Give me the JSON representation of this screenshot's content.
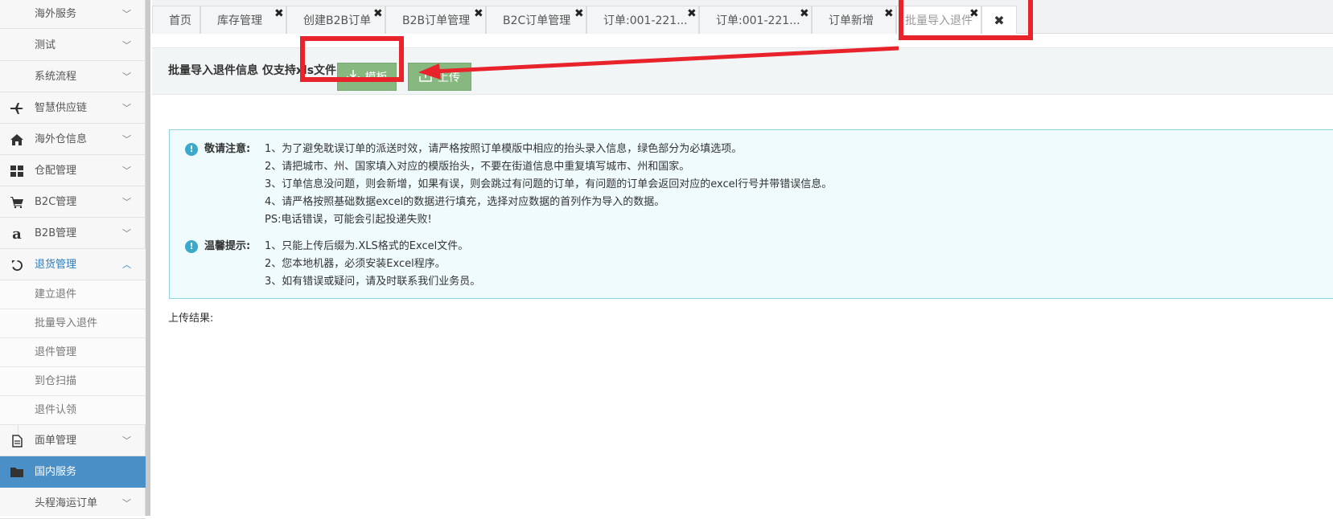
{
  "sidebar": {
    "items": [
      {
        "label": "海外服务",
        "icon": "none"
      },
      {
        "label": "测试",
        "icon": "none"
      },
      {
        "label": "系统流程",
        "icon": "none"
      },
      {
        "label": "智慧供应链",
        "icon": "plane-icon"
      },
      {
        "label": "海外仓信息",
        "icon": "home-icon"
      },
      {
        "label": "仓配管理",
        "icon": "grid-icon"
      },
      {
        "label": "B2C管理",
        "icon": "cart-icon"
      },
      {
        "label": "B2B管理",
        "icon": "amazon-icon"
      },
      {
        "label": "退货管理",
        "icon": "undo-icon"
      }
    ],
    "sub_items": [
      "建立退件",
      "批量导入退件",
      "退件管理",
      "到仓扫描",
      "退件认领"
    ],
    "after_items": [
      {
        "label": "面单管理",
        "icon": "file-icon"
      },
      {
        "label": "国内服务",
        "icon": "folder-icon"
      },
      {
        "label": "头程海运订单",
        "icon": "none"
      }
    ],
    "chevron_down": "﹀",
    "chevron_up": "︿"
  },
  "tabs": [
    {
      "label": "首页",
      "closable": false
    },
    {
      "label": "库存管理",
      "closable": true
    },
    {
      "label": "创建B2B订单",
      "closable": true
    },
    {
      "label": "B2B订单管理",
      "closable": true
    },
    {
      "label": "B2C订单管理",
      "closable": true
    },
    {
      "label": "订单:001-221...",
      "closable": true
    },
    {
      "label": "订单:001-221...",
      "closable": true
    },
    {
      "label": "订单新增",
      "closable": true
    },
    {
      "label": "批量导入退件",
      "closable": true,
      "active": true
    }
  ],
  "tab_close_glyph": "✖",
  "upload": {
    "title": "批量导入退件信息 仅支持xls文件",
    "template_label": "模板",
    "upload_label": "上传"
  },
  "notice": {
    "head1": "敬请注意:",
    "lines1": [
      "1、为了避免耽误订单的派送时效，请严格按照订单模版中相应的抬头录入信息，绿色部分为必填选项。",
      "2、请把城市、州、国家填入对应的模版抬头，不要在街道信息中重复填写城市、州和国家。",
      "3、订单信息没问题，则会新增，如果有误，则会跳过有问题的订单，有问题的订单会返回对应的excel行号并带错误信息。",
      "4、请严格按照基础数据excel的数据进行填充，选择对应数据的首列作为导入的数据。",
      "PS:电话错误，可能会引起投递失败!"
    ],
    "head2": "温馨提示:",
    "lines2": [
      "1、只能上传后缀为.XLS格式的Excel文件。",
      "2、您本地机器，必须安装Excel程序。",
      "3、如有错误或疑问，请及时联系我们业务员。"
    ]
  },
  "result_label": "上传结果:",
  "colors": {
    "accent": "#4a8fc5",
    "button_green": "#87b87f",
    "notice_bg": "#effbfd",
    "annotation_red": "#e8232b"
  }
}
